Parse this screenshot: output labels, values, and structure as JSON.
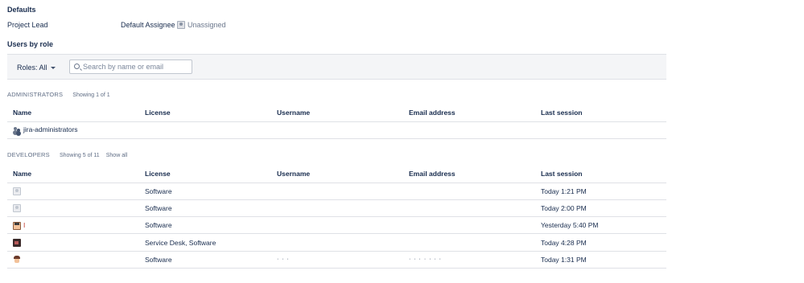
{
  "defaults": {
    "title": "Defaults",
    "project_lead_label": "Project Lead",
    "default_assignee_label": "Default Assignee",
    "default_assignee_value": "Unassigned"
  },
  "users_by_role": {
    "title": "Users by role",
    "roles_button": "Roles: All",
    "search_placeholder": "Search by name or email"
  },
  "columns": [
    "Name",
    "License",
    "Username",
    "Email address",
    "Last session"
  ],
  "administrators": {
    "name": "Administrators",
    "count_text": "Showing 1 of 1",
    "rows": [
      {
        "name": "jira-administrators",
        "license": "",
        "username": "",
        "email": "",
        "last_session": ""
      }
    ]
  },
  "developers": {
    "name": "Developers",
    "count_text": "Showing 5 of 11",
    "show_all": "Show all",
    "rows": [
      {
        "avatar": "default",
        "name": "",
        "license": "Software",
        "username": "",
        "email": "",
        "last_session": "Today 1:21 PM"
      },
      {
        "avatar": "default",
        "name": "",
        "license": "Software",
        "username": "",
        "email": "",
        "last_session": "Today 2:00 PM"
      },
      {
        "avatar": "face1",
        "name": "I",
        "license": "Software",
        "username": "",
        "email": "",
        "last_session": "Yesterday 5:40 PM"
      },
      {
        "avatar": "face2",
        "name": "",
        "license": "Service Desk, Software",
        "username": "",
        "email": "",
        "last_session": "Today 4:28 PM"
      },
      {
        "avatar": "face3",
        "name": "",
        "license": "Software",
        "username": "· · ·",
        "email": "· · · · · · ·",
        "last_session": "Today 1:31 PM"
      }
    ]
  }
}
